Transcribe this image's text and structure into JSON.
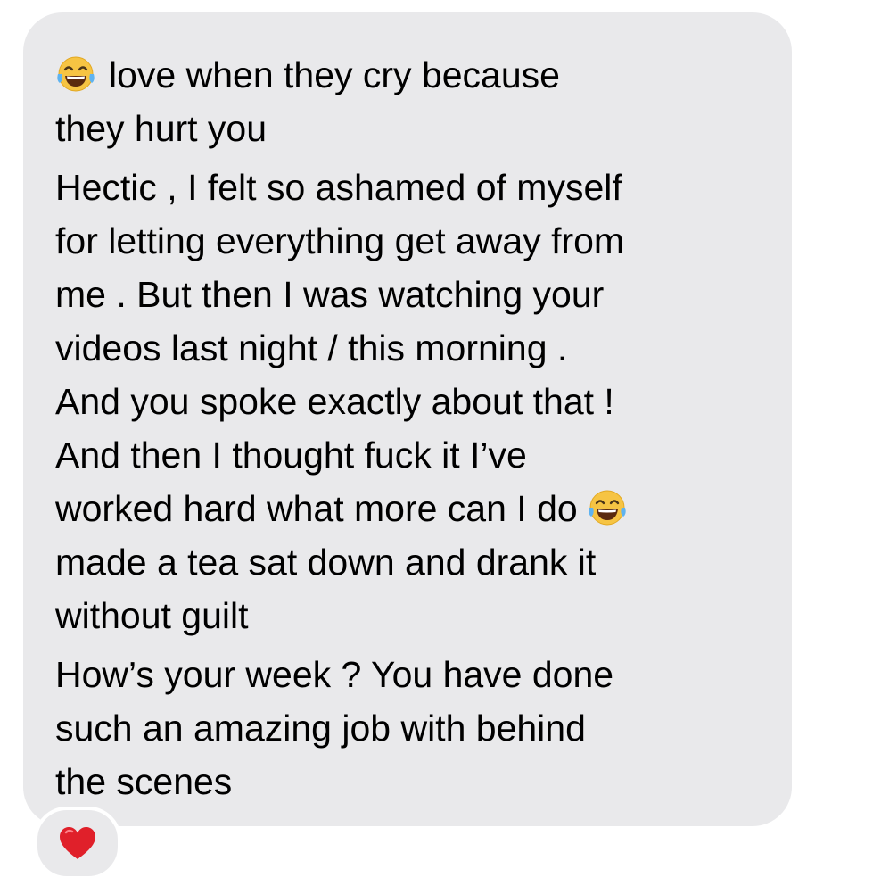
{
  "message": {
    "paragraph_1": {
      "line_1": "love when they cry because",
      "line_2": "they hurt you",
      "leading_emoji": "face-with-tears-of-joy-icon"
    },
    "paragraph_2": {
      "line_1": "Hectic , I felt so ashamed of myself",
      "line_2": "for letting everything get away from",
      "line_3": "me . But then I was watching your",
      "line_4": "videos last night / this morning .",
      "line_5": "And you spoke exactly about that !",
      "line_6": "And then I thought fuck it I’ve",
      "line_7": "worked hard what more can I do",
      "line_8": "made a tea sat down and drank it",
      "line_9": "without guilt",
      "inline_emoji": "face-with-tears-of-joy-icon"
    },
    "paragraph_3": {
      "line_1": "How’s your week ? You have done",
      "line_2": "such an amazing job with behind",
      "line_3": "the scenes"
    }
  },
  "reaction": {
    "icon": "red-heart-icon"
  },
  "colors": {
    "bubble_background": "#e9e9eb",
    "page_background": "#ffffff",
    "text": "#000000",
    "heart": "#e0202a"
  }
}
